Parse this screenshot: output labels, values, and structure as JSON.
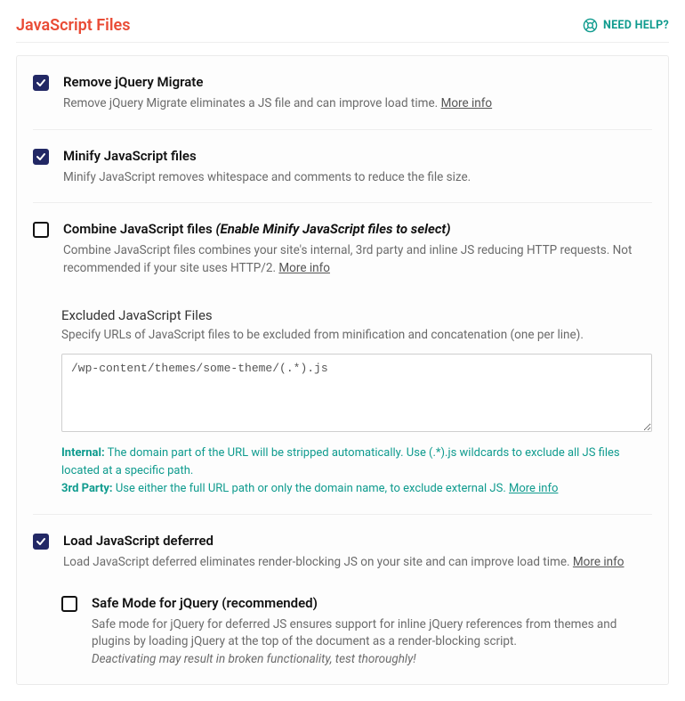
{
  "header": {
    "title": "JavaScript Files",
    "help_label": "NEED HELP?"
  },
  "common": {
    "more_info": "More info"
  },
  "settings": {
    "remove_migrate": {
      "checked": true,
      "title": "Remove jQuery Migrate",
      "desc": "Remove jQuery Migrate eliminates a JS file and can improve load time."
    },
    "minify": {
      "checked": true,
      "title": "Minify JavaScript files",
      "desc": "Minify JavaScript removes whitespace and comments to reduce the file size."
    },
    "combine": {
      "checked": false,
      "title": "Combine JavaScript files",
      "notice": "(Enable Minify JavaScript files to select)",
      "desc": "Combine JavaScript files combines your site's internal, 3rd party and inline JS reducing HTTP requests. Not recommended if your site uses HTTP/2."
    },
    "excluded": {
      "label": "Excluded JavaScript Files",
      "sublabel": "Specify URLs of JavaScript files to be excluded from minification and concatenation (one per line).",
      "value": "/wp-content/themes/some-theme/(.*).js",
      "hint_internal_label": "Internal:",
      "hint_internal_text": " The domain part of the URL will be stripped automatically. Use (.*).js wildcards to exclude all JS files located at a specific path.",
      "hint_3p_label": "3rd Party:",
      "hint_3p_text": " Use either the full URL path or only the domain name, to exclude external JS."
    },
    "deferred": {
      "checked": true,
      "title": "Load JavaScript deferred",
      "desc": "Load JavaScript deferred eliminates render-blocking JS on your site and can improve load time."
    },
    "safe_mode": {
      "checked": false,
      "title": "Safe Mode for jQuery (recommended)",
      "desc": "Safe mode for jQuery for deferred JS ensures support for inline jQuery references from themes and plugins by loading jQuery at the top of the document as a render-blocking script.",
      "warning": "Deactivating may result in broken functionality, test thoroughly!"
    }
  }
}
